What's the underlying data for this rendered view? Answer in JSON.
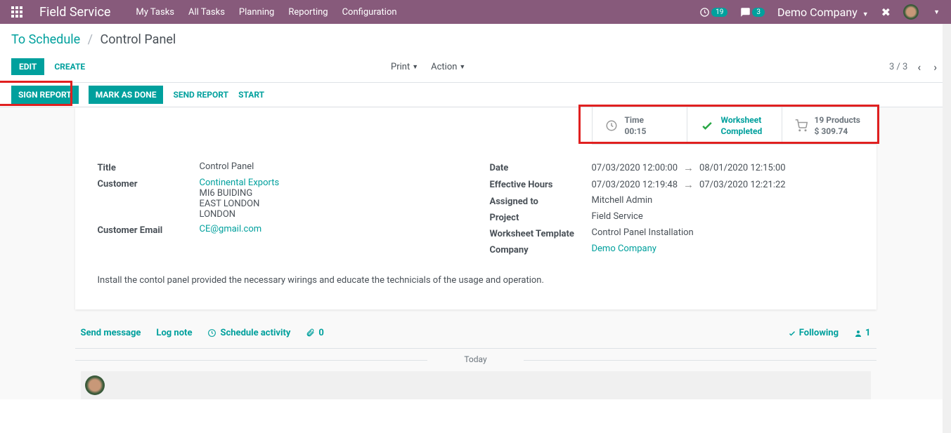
{
  "nav": {
    "brand": "Field Service",
    "menu": [
      "My Tasks",
      "All Tasks",
      "Planning",
      "Reporting",
      "Configuration"
    ],
    "clock_badge": "19",
    "chat_badge": "3",
    "company": "Demo Company "
  },
  "breadcrumb": {
    "parent": "To Schedule",
    "current": "Control Panel"
  },
  "cp": {
    "edit": "EDIT",
    "create": "CREATE",
    "print": "Print",
    "action": "Action",
    "pager": "3 / 3"
  },
  "status": {
    "sign_report": "SIGN REPORT",
    "mark_done": "MARK AS DONE",
    "send_report": "SEND REPORT",
    "start": "START"
  },
  "stats": {
    "time_label": "Time",
    "time_value": "00:15",
    "worksheet_label": "Worksheet",
    "worksheet_value": "Completed",
    "products_label": "19 Products",
    "products_value": "$ 309.74"
  },
  "form": {
    "title_label": "Title",
    "title_value": "Control Panel",
    "customer_label": "Customer",
    "customer_name": "Continental Exports",
    "customer_addr1": "MI6 BUIDING",
    "customer_addr2": "EAST LONDON",
    "customer_addr3": "LONDON",
    "customer_email_label": "Customer Email",
    "customer_email": "CE@gmail.com",
    "date_label": "Date",
    "date_from": "07/03/2020 12:00:00",
    "date_to": "08/01/2020 12:15:00",
    "eff_label": "Effective Hours",
    "eff_from": "07/03/2020 12:19:48",
    "eff_to": "07/03/2020 12:21:22",
    "assigned_label": "Assigned to",
    "assigned_value": "Mitchell Admin",
    "project_label": "Project",
    "project_value": "Field Service",
    "template_label": "Worksheet Template",
    "template_value": "Control Panel Installation",
    "company_label": "Company",
    "company_value": "Demo Company",
    "description": "Install the contol panel provided the necessary wirings and educate the technicials of the usage and operation."
  },
  "chatter": {
    "send": "Send message",
    "log": "Log note",
    "schedule": "Schedule activity",
    "attachments": "0",
    "following": "Following",
    "followers": "1",
    "today": "Today"
  }
}
